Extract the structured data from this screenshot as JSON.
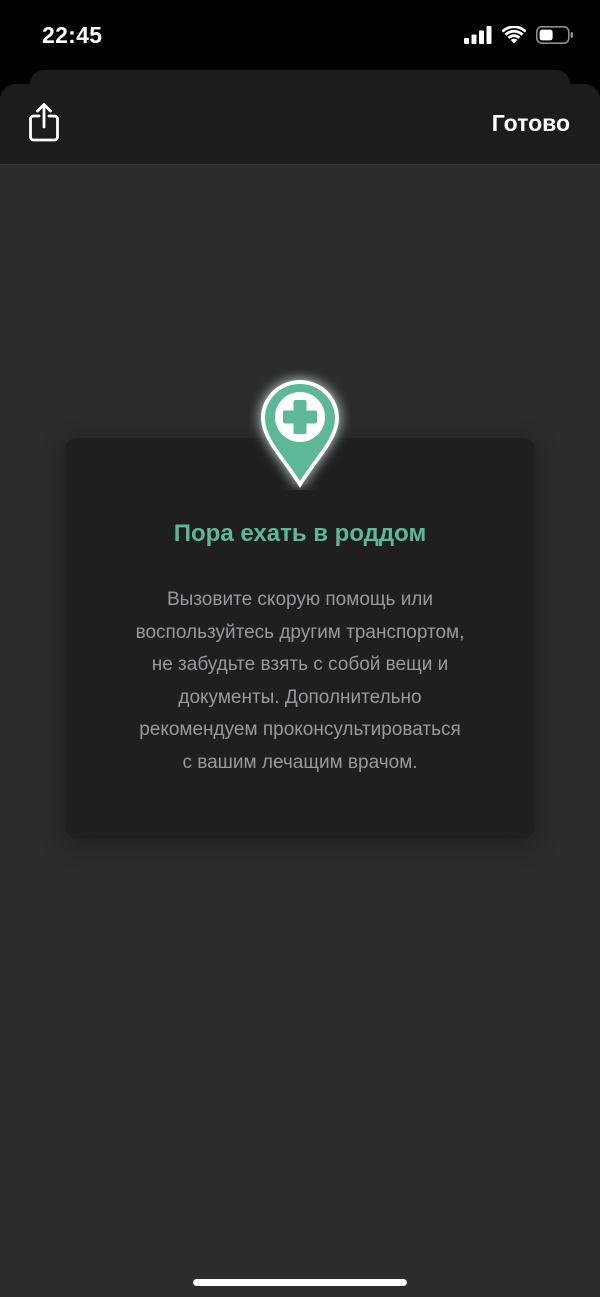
{
  "status_bar": {
    "time": "22:45",
    "icons": [
      "cellular-signal-icon",
      "wifi-icon",
      "battery-icon"
    ]
  },
  "header": {
    "share_icon": "share-icon",
    "done_label": "Готово"
  },
  "card": {
    "icon": "hospital-location-pin-icon",
    "title": "Пора ехать в роддом",
    "body_lines": [
      "Вызовите скорую помощь или",
      "воспользуйтесь другим транспортом,",
      "не забудьте взять с собой вещи и",
      "документы. Дополнительно",
      "рекомендуем проконсультироваться",
      "с вашим лечащим врачом."
    ]
  },
  "colors": {
    "accent": "#5cb897",
    "sheet_background": "#2c2c2e",
    "card_background": "#1f1f21",
    "header_background": "#1c1c1e",
    "body_text": "#98989e"
  }
}
